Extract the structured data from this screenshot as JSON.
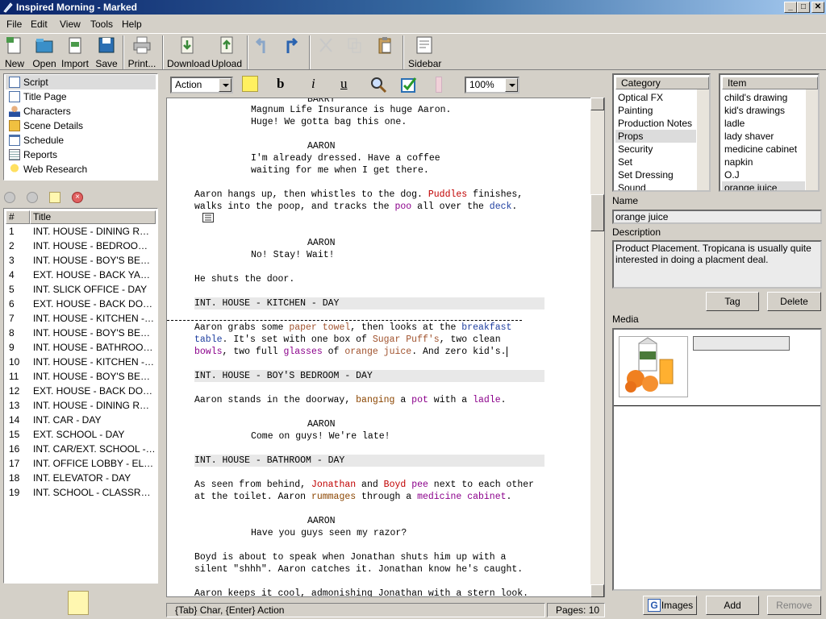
{
  "window": {
    "title": "Inspired Morning - Marked",
    "min": "_",
    "max": "□",
    "close": "✕"
  },
  "menu": [
    "File",
    "Edit",
    "View",
    "Tools",
    "Help"
  ],
  "toolbar": {
    "new": "New",
    "open": "Open",
    "import": "Import",
    "save": "Save",
    "print": "Print...",
    "download": "Download",
    "upload": "Upload",
    "sidebar": "Sidebar"
  },
  "nav": [
    "Script",
    "Title Page",
    "Characters",
    "Scene Details",
    "Schedule",
    "Reports",
    "Web Research"
  ],
  "scenes": {
    "col_num": "#",
    "col_title": "Title",
    "rows": [
      {
        "n": "1",
        "t": "INT. HOUSE - DINING ROOM - DAY"
      },
      {
        "n": "2",
        "t": "INT. HOUSE - BEDROOM - DAY"
      },
      {
        "n": "3",
        "t": "INT. HOUSE - BOY'S BEDROOM - DAY"
      },
      {
        "n": "4",
        "t": "EXT. HOUSE - BACK YARD - DAY"
      },
      {
        "n": "5",
        "t": "INT. SLICK OFFICE - DAY"
      },
      {
        "n": "6",
        "t": "EXT. HOUSE - BACK DOOR - DAY"
      },
      {
        "n": "7",
        "t": "INT. HOUSE - KITCHEN - DAY"
      },
      {
        "n": "8",
        "t": "INT. HOUSE - BOY'S BEDROOM - DAY"
      },
      {
        "n": "9",
        "t": "INT. HOUSE - BATHROOM - DAY"
      },
      {
        "n": "10",
        "t": "INT. HOUSE - KITCHEN - DAY"
      },
      {
        "n": "11",
        "t": "INT. HOUSE - BOY'S BEDROOM - DAY"
      },
      {
        "n": "12",
        "t": "EXT. HOUSE - BACK DOOR - DAY"
      },
      {
        "n": "13",
        "t": "INT. HOUSE - DINING ROOM - DAY"
      },
      {
        "n": "14",
        "t": "INT. CAR - DAY"
      },
      {
        "n": "15",
        "t": "EXT. SCHOOL - DAY"
      },
      {
        "n": "16",
        "t": "INT. CAR/EXT. SCHOOL - CONTINUOUS"
      },
      {
        "n": "17",
        "t": "INT. OFFICE LOBBY - ELEVATOR - DAY"
      },
      {
        "n": "18",
        "t": "INT. ELEVATOR - DAY"
      },
      {
        "n": "19",
        "t": "INT. SCHOOL - CLASSROOM - DAY"
      }
    ]
  },
  "editor": {
    "element_type": "Action",
    "zoom": "100%",
    "status": "{Tab} Char, {Enter} Action",
    "pages": "Pages: 10"
  },
  "script": {
    "top_partial": "BARRY",
    "l1": "Magnum Life Insurance is huge Aaron.",
    "l2": "Huge! We gotta bag this one.",
    "aaron": "AARON",
    "l3": "I'm already dressed. Have a coffee",
    "l4": "waiting for me when I get there.",
    "l5a": "Aaron hangs up, then whistles to the dog. ",
    "l5b": "Puddles",
    "l5c": " finishes,",
    "l6a": "walks into the poop, and tracks the ",
    "l6b": "poo",
    "l6c": " all over the ",
    "l6d": "deck",
    "l6e": ".",
    "l7": "No! Stay! Wait!",
    "l8": "He shuts the door.",
    "slug1": "INT. HOUSE - KITCHEN - DAY",
    "l9a": "Aaron grabs some ",
    "l9b": "paper towel",
    "l9c": ", then looks at the ",
    "l9d": "breakfast",
    "l10a": "table",
    "l10b": ". It's set with one box of ",
    "l10c": "Sugar Puff's",
    "l10d": ", two clean",
    "l11a": "bowls",
    "l11b": ", two full ",
    "l11c": "glasses",
    "l11d": " of ",
    "l11e": "orange juice",
    "l11f": ". And zero kid's.",
    "slug2": "INT. HOUSE - BOY'S BEDROOM - DAY",
    "l12a": "Aaron stands in the doorway, ",
    "l12b": "banging",
    "l12c": " a ",
    "l12d": "pot",
    "l12e": " with a ",
    "l12f": "ladle",
    "l12g": ".",
    "l13": "Come on guys! We're late!",
    "slug3": "INT. HOUSE - BATHROOM - DAY",
    "l14a": "As seen from behind, ",
    "l14b": "Jonathan",
    "l14c": " and ",
    "l14d": "Boyd",
    "l14e": " ",
    "l14f": "pee",
    "l14g": " next to each other",
    "l15a": "at the toilet. Aaron ",
    "l15b": "rummages",
    "l15c": " through a ",
    "l15d": "medicine cabinet",
    "l15e": ".",
    "l16": "Have you guys seen my razor?",
    "l17": "Boyd is about to speak when Jonathan shuts him up with a",
    "l18": "silent \"shhh\". Aaron catches it. Jonathan know he's caught.",
    "l19": "Aaron keeps it cool, admonishing Jonathan with a stern look."
  },
  "category": {
    "header": "Category",
    "items": [
      "Optical FX",
      "Painting",
      "Production Notes",
      "Props",
      "Security",
      "Set",
      "Set Dressing",
      "Sound"
    ],
    "selected": "Props"
  },
  "item": {
    "header": "Item",
    "items": [
      "child's drawing",
      "kid's drawings",
      "ladle",
      "lady shaver",
      "medicine cabinet",
      "napkin",
      "O.J",
      "orange juice"
    ],
    "selected": "orange juice"
  },
  "details": {
    "name_label": "Name",
    "name_value": "orange juice",
    "desc_label": "Description",
    "desc_value": "Product Placement. Tropicana is usually quite interested in doing a placment deal.",
    "tag_button": "Tag",
    "delete_button": "Delete",
    "media_label": "Media",
    "images_button": "Images",
    "add_button": "Add",
    "remove_button": "Remove"
  },
  "colors": {
    "tag_prop": "#a0522d",
    "tag_character": "#c00000",
    "tag_set": "#8b008b",
    "tag_blue": "#1f3fa0",
    "slugline_bg": "#e8e8e8"
  }
}
